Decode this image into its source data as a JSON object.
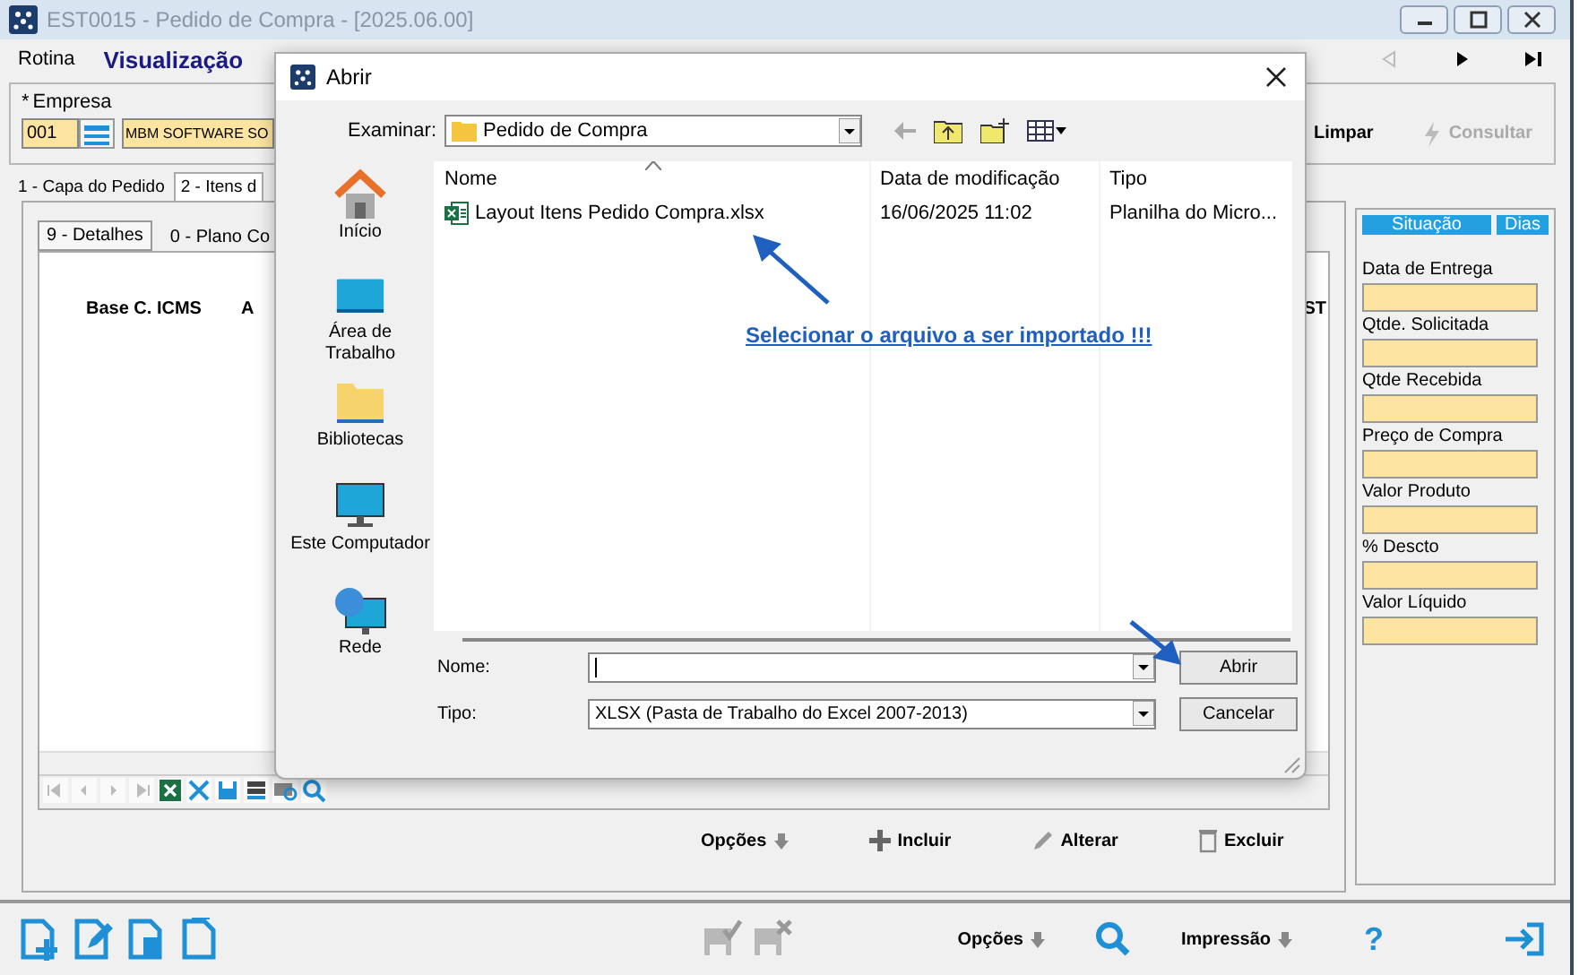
{
  "window": {
    "title": "EST0015 - Pedido de Compra - [2025.06.00]"
  },
  "menu": [
    {
      "label": "Rotina",
      "selected": false
    },
    {
      "label": "Visualização",
      "selected": true
    }
  ],
  "record_nav": [
    {
      "kind": "prev",
      "disabled": true
    },
    {
      "kind": "next",
      "disabled": false
    },
    {
      "kind": "last",
      "disabled": false
    }
  ],
  "empresa": {
    "required_mark": "*",
    "label": "Empresa",
    "code": "001",
    "name": "MBM SOFTWARE SO"
  },
  "actions": [
    {
      "label": "Limpar",
      "disabled": false
    },
    {
      "label": "Consultar",
      "disabled": true
    }
  ],
  "tabs": [
    {
      "label": "1 - Capa do Pedido",
      "selected": false
    },
    {
      "label": "2 - Itens d",
      "selected": true
    }
  ],
  "subtabs": [
    {
      "label": "9 - Detalhes",
      "selected": true
    },
    {
      "label": "0 - Plano Co",
      "selected": false
    }
  ],
  "grid": {
    "columns": [
      "Base C. ICMS",
      "A",
      "ST"
    ]
  },
  "grid_actions": [
    {
      "label": "Opções",
      "kind": "menu"
    },
    {
      "label": "Incluir",
      "kind": "add"
    },
    {
      "label": "Alterar",
      "kind": "edit"
    },
    {
      "label": "Excluir",
      "kind": "delete"
    }
  ],
  "detail_panel": {
    "headers": [
      "Situação",
      "Dias"
    ],
    "fields": [
      "Data de Entrega",
      "Qtde. Solicitada",
      "Qtde Recebida",
      "Preço de Compra",
      "Valor Produto",
      "% Descto",
      "Valor Líquido"
    ]
  },
  "bottom_bar": {
    "left_buttons": [
      {
        "kind": "new"
      },
      {
        "kind": "edit"
      },
      {
        "kind": "delete"
      },
      {
        "kind": "copy"
      }
    ],
    "confirm_buttons": [
      {
        "kind": "confirm",
        "disabled": true
      },
      {
        "kind": "cancel",
        "disabled": true
      }
    ],
    "items": [
      {
        "kind": "menu",
        "label": "Opções"
      },
      {
        "kind": "search"
      },
      {
        "kind": "menu",
        "label": "Impressão"
      },
      {
        "kind": "help",
        "label": "?"
      },
      {
        "kind": "exit"
      }
    ]
  },
  "dialog": {
    "title": "Abrir",
    "look_in_label": "Examinar:",
    "look_in": "Pedido de Compra",
    "places": [
      {
        "label": "Início",
        "kind": "home"
      },
      {
        "label": "Área de Trabalho",
        "kind": "desktop"
      },
      {
        "label": "Bibliotecas",
        "kind": "library"
      },
      {
        "label": "Este Computador",
        "kind": "computer"
      },
      {
        "label": "Rede",
        "kind": "network"
      }
    ],
    "columns": [
      "Nome",
      "Data de modificação",
      "Tipo"
    ],
    "files": [
      {
        "name": "Layout Itens Pedido Compra.xlsx",
        "modified": "16/06/2025 11:02",
        "type": "Planilha do Micro...",
        "selected": false
      }
    ],
    "annotation": "Selecionar o arquivo a ser importado !!!",
    "name_label": "Nome:",
    "type_label": "Tipo:",
    "type_value": "XLSX (Pasta de Trabalho do Excel 2007-2013)",
    "buttons": [
      "Abrir",
      "Cancelar"
    ]
  }
}
